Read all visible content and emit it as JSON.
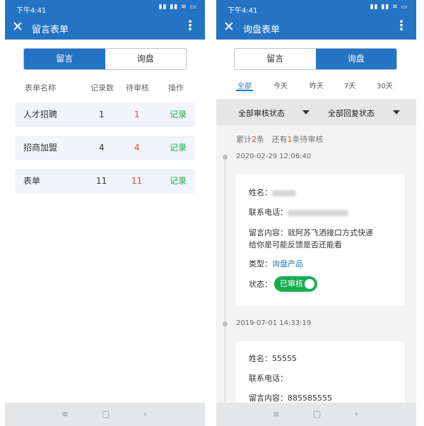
{
  "status_bar": {
    "time": "下午4:41",
    "icons": "▮▮ ▮▮ ≋ ▭"
  },
  "left": {
    "title": "留言表单",
    "segments": [
      "留言",
      "询盘"
    ],
    "columns": {
      "name": "表单名称",
      "count": "记录数",
      "pending": "待审核",
      "op": "操作"
    },
    "rows": [
      {
        "name": "人才招聘",
        "count": "1",
        "pending": "1",
        "op": "记录"
      },
      {
        "name": "招商加盟",
        "count": "4",
        "pending": "4",
        "op": "记录"
      },
      {
        "name": "表单",
        "count": "11",
        "pending": "11",
        "op": "记录"
      }
    ]
  },
  "right": {
    "title": "询盘表单",
    "segments": [
      "留言",
      "询盘"
    ],
    "tabs": [
      "全部",
      "今天",
      "昨天",
      "7天",
      "30天"
    ],
    "filters": [
      "全部审核状态",
      "全部回复状态"
    ],
    "summary": {
      "prefix": "累计",
      "total": "2",
      "mid": "条   还有",
      "pending": "1",
      "suffix": "条待审核"
    },
    "entries": [
      {
        "date": "2020-02-29 12:06:40",
        "name_label": "姓名：",
        "name_value": "吴**",
        "phone_label": "联系电话：",
        "phone_value": "136********",
        "message_label": "留言内容：",
        "message_line1": "就阿苏飞洒接口方式快递",
        "message_line2": "给你是可能反馈是否还能看",
        "type_label": "类型：",
        "type_value": "询盘产品",
        "status_label": "状态：",
        "status_value": "已审核"
      },
      {
        "date": "2019-07-01 14:33:19",
        "name_label": "姓名：",
        "name_value": "55555",
        "phone_label": "联系电话：",
        "phone_value": "",
        "message_label": "留言内容：",
        "message_value": "885585555"
      }
    ]
  },
  "nav": {
    "menu": "≡",
    "home": "▢",
    "back": "‹"
  },
  "colors": {
    "primary": "#2574c4",
    "success": "#1aad50",
    "danger": "#e64a3b"
  }
}
